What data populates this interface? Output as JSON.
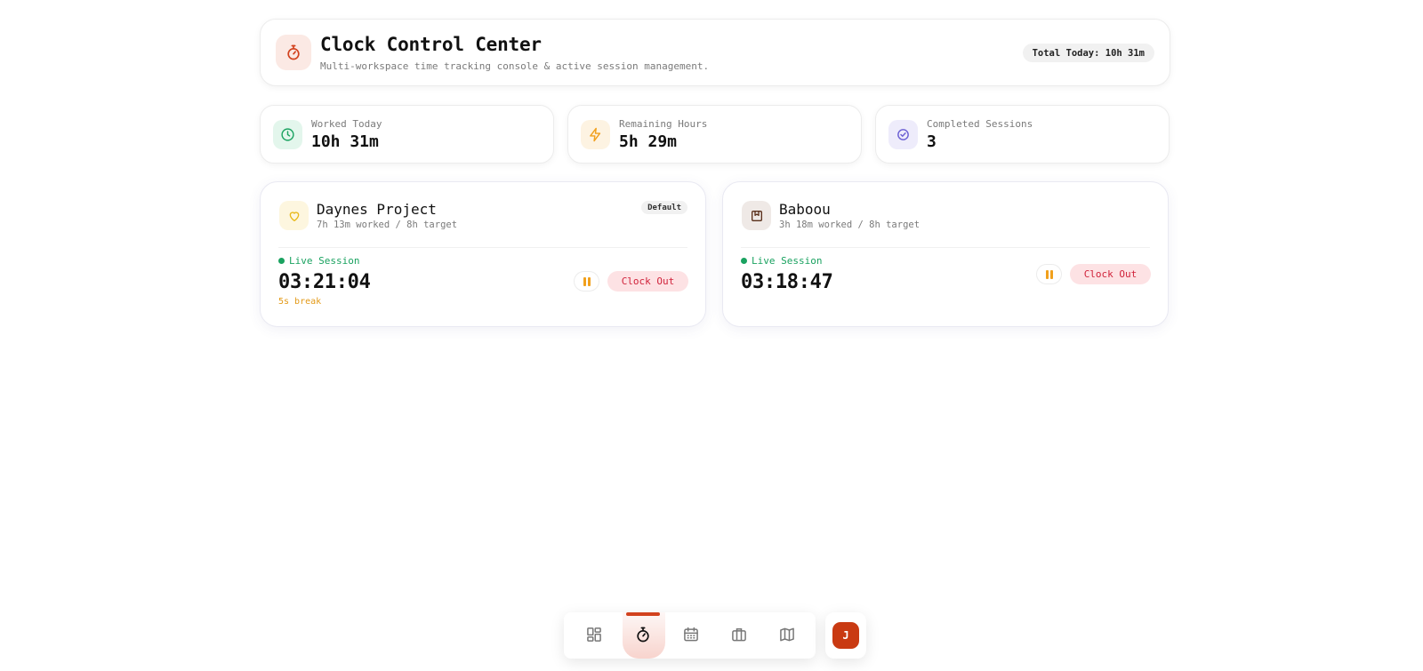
{
  "header": {
    "title": "Clock Control Center",
    "subtitle": "Multi-workspace time tracking console & active session management.",
    "total_badge": "Total Today: 10h 31m",
    "icon": "stopwatch-icon"
  },
  "stats": [
    {
      "label": "Worked Today",
      "value": "10h 31m",
      "icon": "clock-icon",
      "color": "#1aa260"
    },
    {
      "label": "Remaining Hours",
      "value": "5h 29m",
      "icon": "lightning-icon",
      "color": "#f1a01c"
    },
    {
      "label": "Completed Sessions",
      "value": "3",
      "icon": "check-circle-icon",
      "color": "#6b5fd3"
    }
  ],
  "workspaces": [
    {
      "name": "Daynes Project",
      "meta": "7h 13m worked / 8h target",
      "badge": "Default",
      "icon": "heart-icon",
      "live_label": "Live Session",
      "timer": "03:21:04",
      "break_note": "5s break",
      "clock_out_label": "Clock Out"
    },
    {
      "name": "Baboou",
      "meta": "3h 18m worked / 8h target",
      "icon": "bookmark-box-icon",
      "live_label": "Live Session",
      "timer": "03:18:47",
      "clock_out_label": "Clock Out"
    }
  ],
  "nav": {
    "items": [
      "dashboard-icon",
      "stopwatch-icon",
      "calendar-icon",
      "briefcase-icon",
      "map-icon"
    ],
    "active": "stopwatch-icon",
    "avatar_initial": "J"
  },
  "colors": {
    "accent": "#d2421e",
    "live": "#1aa260",
    "warning": "#f1a01c",
    "danger": "#d0223a"
  }
}
